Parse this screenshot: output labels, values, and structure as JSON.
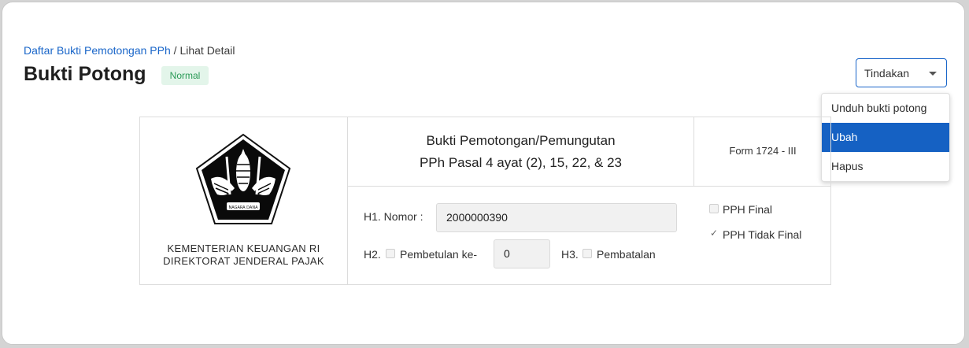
{
  "breadcrumb": {
    "parent": "Daftar Bukti Pemotongan PPh",
    "separator": " / ",
    "current": "Lihat Detail"
  },
  "page": {
    "title": "Bukti Potong",
    "status": "Normal"
  },
  "actions": {
    "dropdown_label": "Tindakan",
    "menu": [
      {
        "label": "Unduh bukti potong",
        "selected": false
      },
      {
        "label": "Ubah",
        "selected": true
      },
      {
        "label": "Hapus",
        "selected": false
      }
    ]
  },
  "document": {
    "org_line1": "KEMENTERIAN KEUANGAN RI",
    "org_line2": "DIREKTORAT JENDERAL PAJAK",
    "title_line1": "Bukti Pemotongan/Pemungutan",
    "title_line2": "PPh Pasal 4 ayat (2), 15, 22, & 23",
    "form_code": "Form 1724 - III",
    "h1_label": "H1. Nomor :",
    "h1_value": "2000000390",
    "h2_label": "H2.",
    "h2_checkbox_label": "Pembetulan ke-",
    "h2_checked": false,
    "h2_value": "0",
    "h3_label": "H3.",
    "h3_checkbox_label": "Pembatalan",
    "h3_checked": false,
    "pph_final_label": "PPH Final",
    "pph_final_checked": false,
    "pph_tidak_final_label": "PPH Tidak Final",
    "pph_tidak_final_checked": true
  },
  "colors": {
    "link": "#1a66c9",
    "badge_bg": "#e3f5ea",
    "badge_text": "#2a9a56",
    "menu_active": "#1561c3"
  }
}
